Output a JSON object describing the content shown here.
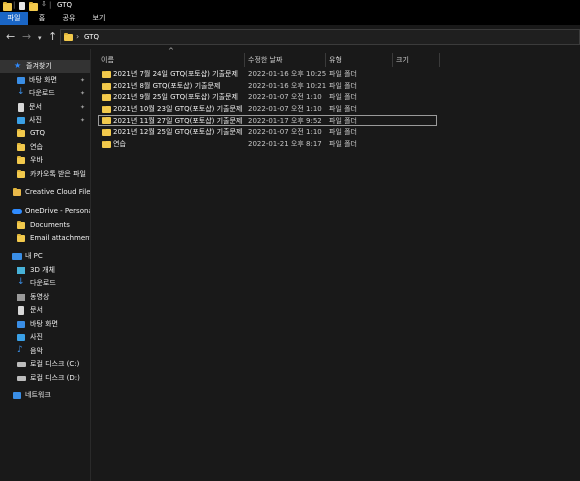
{
  "window": {
    "title": "GTQ"
  },
  "ribbon": {
    "tabs": [
      "파일",
      "홈",
      "공유",
      "보기"
    ]
  },
  "address": {
    "path": "GTQ",
    "separator": "›"
  },
  "nav": {
    "back": "←",
    "forward": "→",
    "recent": "▾",
    "up": "↑"
  },
  "sidebar": {
    "quick_access": {
      "label": "즐겨찾기",
      "items": [
        "바탕 화면",
        "다운로드",
        "문서",
        "사진",
        "GTQ",
        "연습",
        "우바",
        "카카오톡 받은 파일"
      ]
    },
    "creative_cloud": "Creative Cloud Files",
    "onedrive": {
      "label": "OneDrive - Personal",
      "items": [
        "Documents",
        "Email attachments"
      ]
    },
    "this_pc": {
      "label": "내 PC",
      "items": [
        "3D 개체",
        "다운로드",
        "동영상",
        "문서",
        "바탕 화면",
        "사진",
        "음악",
        "로컬 디스크 (C:)",
        "로컬 디스크 (D:)"
      ]
    },
    "network": "네트워크"
  },
  "columns": [
    "이름",
    "수정한 날짜",
    "유형",
    "크기"
  ],
  "files": [
    {
      "name": "2021년 7월 24일 GTQ(포토샵) 기출문제",
      "date": "2022-01-16 오후 10:25",
      "type": "파일 폴더"
    },
    {
      "name": "2021년 8월 GTQ(포토샵) 기출문제",
      "date": "2022-01-16 오후 10:21",
      "type": "파일 폴더"
    },
    {
      "name": "2021년 9월 25일 GTQ(포토샵) 기출문제",
      "date": "2022-01-07 오전 1:10",
      "type": "파일 폴더"
    },
    {
      "name": "2021년 10월 23일 GTQ(포토샵) 기출문제",
      "date": "2022-01-07 오전 1:10",
      "type": "파일 폴더"
    },
    {
      "name": "2021년 11월 27일 GTQ(포토샵) 기출문제",
      "date": "2022-01-17 오후 9:52",
      "type": "파일 폴더"
    },
    {
      "name": "2021년 12월 25일 GTQ(포토샵) 기출문제",
      "date": "2022-01-07 오전 1:10",
      "type": "파일 폴더"
    },
    {
      "name": "연습",
      "date": "2022-01-21 오후 8:17",
      "type": "파일 폴더"
    }
  ],
  "colors": {
    "accent": "#1a66c6",
    "folder": "#f2c94c",
    "background": "#191919"
  }
}
